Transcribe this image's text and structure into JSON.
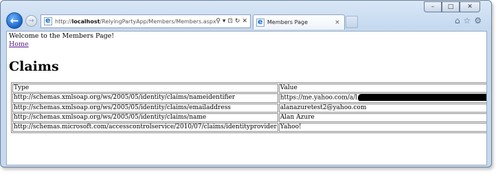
{
  "browser": {
    "address": {
      "prefix": "http://",
      "host": "localhost",
      "path": "/RelyingPartyApp/Members/Members.aspx",
      "tools": [
        "search-icon",
        "dropdown-icon",
        "compat-icon",
        "refresh-icon",
        "stop-icon"
      ]
    },
    "tab": {
      "title": "Members Page",
      "close": "×"
    },
    "controls": {
      "minimize": "–",
      "maximize": "□",
      "close": "✕"
    },
    "right_icons": {
      "home": "⌂",
      "favorites": "☆",
      "tools": "⚙"
    }
  },
  "page": {
    "welcome": "Welcome to the Members Page!",
    "home_link": "Home",
    "heading": "Claims",
    "table": {
      "headers": [
        "Type",
        "Value"
      ],
      "rows": [
        {
          "type": "http://schemas.xmlsoap.org/ws/2005/05/identity/claims/nameidentifier",
          "value": "https://me.yahoo.com/a/l",
          "redacted": true
        },
        {
          "type": "http://schemas.xmlsoap.org/ws/2005/05/identity/claims/emailaddress",
          "value": "alanazuretest2@yahoo.com"
        },
        {
          "type": "http://schemas.xmlsoap.org/ws/2005/05/identity/claims/name",
          "value": "Alan Azure"
        },
        {
          "type": "http://schemas.microsoft.com/accesscontrolservice/2010/07/claims/identityprovider",
          "value": "Yahoo!"
        }
      ]
    }
  }
}
